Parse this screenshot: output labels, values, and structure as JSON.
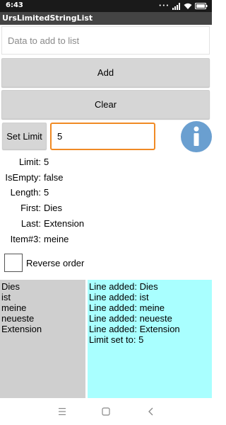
{
  "status_bar": {
    "time": "6:43",
    "dots": "•••",
    "battery_icon": "battery-icon",
    "wifi_icon": "wifi-icon",
    "signal_icon": "signal-icon"
  },
  "app": {
    "title": "UrsLimitedStringList"
  },
  "input": {
    "placeholder": "Data to add to list",
    "value": ""
  },
  "buttons": {
    "add_label": "Add",
    "clear_label": "Clear",
    "set_limit_label": "Set Limit"
  },
  "limit_input": {
    "value": "5"
  },
  "info_icon": "info-icon",
  "properties": [
    {
      "label": "Limit:",
      "value": "5"
    },
    {
      "label": "IsEmpty:",
      "value": "false"
    },
    {
      "label": "Length:",
      "value": "5"
    },
    {
      "label": "First:",
      "value": "Dies"
    },
    {
      "label": "Last:",
      "value": "Extension"
    },
    {
      "label": "Item#3:",
      "value": "meine"
    }
  ],
  "checkbox": {
    "label": "Reverse order",
    "checked": false
  },
  "list": {
    "items": [
      "Dies",
      "ist",
      "meine",
      "neueste",
      "Extension"
    ]
  },
  "log": {
    "lines": [
      "Line added: Dies",
      "Line added: ist",
      "Line added: meine",
      "Line added: neueste",
      "Line added: Extension",
      "Limit set to: 5"
    ]
  },
  "nav": {
    "menu_icon": "menu-icon",
    "home_icon": "home-icon",
    "back_icon": "back-icon"
  },
  "colors": {
    "title_bar": "#444444",
    "limit_border": "#f08a24",
    "info_circle": "#6a9fd0",
    "list_bg": "#cfcfcf",
    "log_bg": "#a9ffff"
  }
}
